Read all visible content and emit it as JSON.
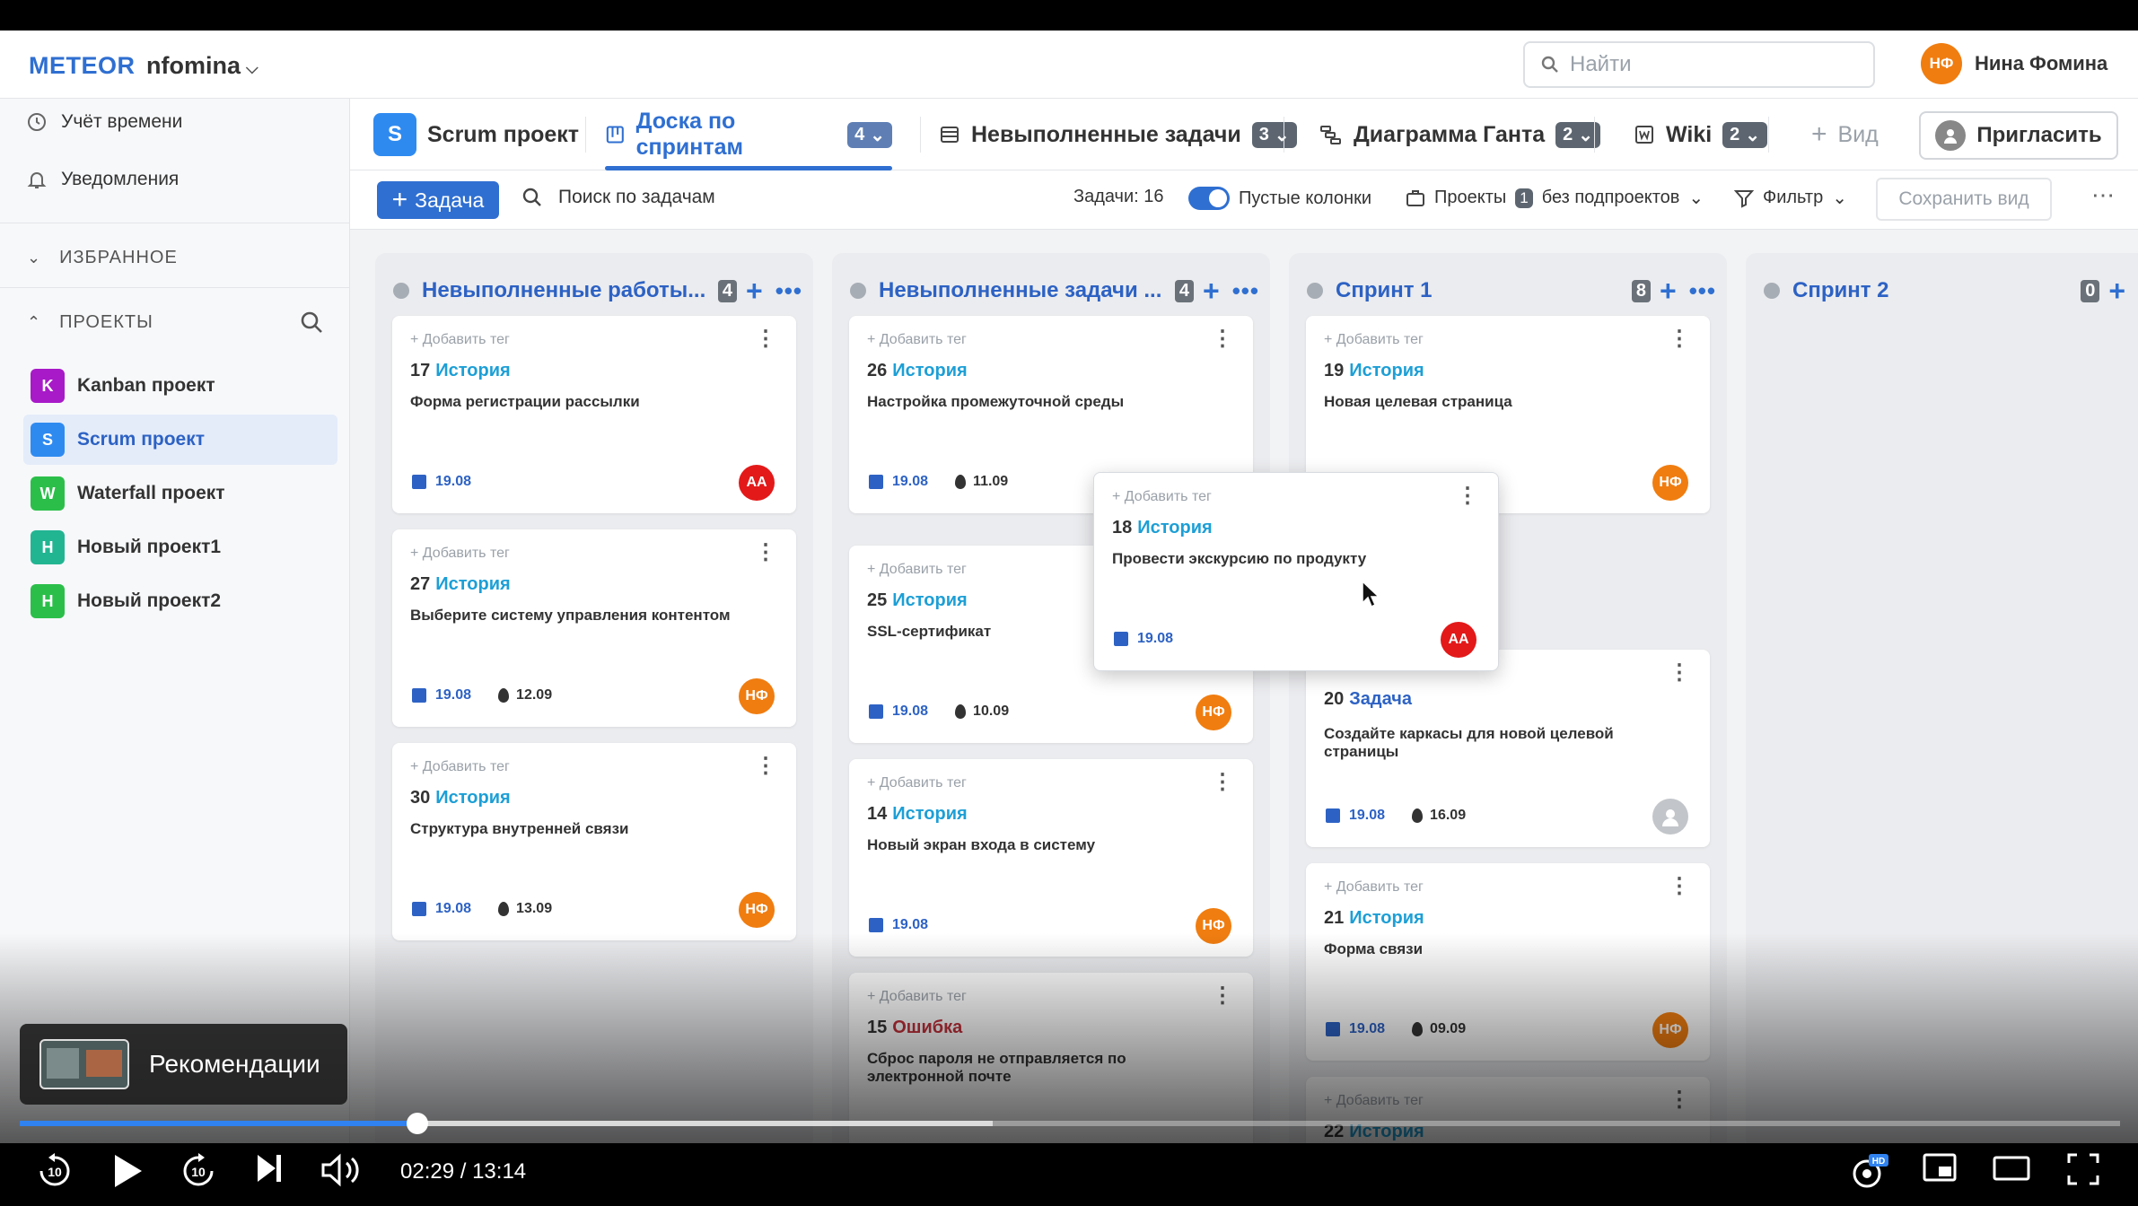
{
  "topbar": {
    "logo": "METEOR",
    "workspace": "nfomina",
    "search_placeholder": "Найти",
    "user_initials": "НФ",
    "user_name": "Нина Фомина"
  },
  "sidebar": {
    "time_tracking": "Учёт времени",
    "notifications": "Уведомления",
    "favorites_label": "ИЗБРАННОЕ",
    "projects_label": "ПРОЕКТЫ",
    "projects": [
      {
        "letter": "K",
        "name": "Kanban проект",
        "color": "#a81ac8"
      },
      {
        "letter": "S",
        "name": "Scrum проект",
        "color": "#2f8af0"
      },
      {
        "letter": "W",
        "name": "Waterfall проект",
        "color": "#2bbf4a"
      },
      {
        "letter": "Н",
        "name": "Новый проект1",
        "color": "#22b592"
      },
      {
        "letter": "Н",
        "name": "Новый проект2",
        "color": "#2bbf4a"
      }
    ]
  },
  "viewtabs": {
    "project_letter": "S",
    "project_name": "Scrum проект",
    "tabs": [
      {
        "label": "Доска по спринтам",
        "count": "4"
      },
      {
        "label": "Невыполненные задачи",
        "count": "3"
      },
      {
        "label": "Диаграмма Ганта",
        "count": "2"
      },
      {
        "label": "Wiki",
        "count": "2"
      }
    ],
    "add_view": "Вид",
    "invite": "Пригласить"
  },
  "toolbar": {
    "add_task": "Задача",
    "search_label": "Поиск по задачам",
    "tasks_count": "Задачи: 16",
    "empty_columns": "Пустые колонки",
    "projects": "Проекты",
    "projects_count": "1",
    "subprojects": "без подпроектов",
    "filter": "Фильтр",
    "save_view": "Сохранить вид"
  },
  "columns": [
    {
      "title": "Невыполненные работы...",
      "count": "4"
    },
    {
      "title": "Невыполненные задачи ...",
      "count": "4"
    },
    {
      "title": "Спринт 1",
      "count": "8"
    },
    {
      "title": "Спринт 2",
      "count": "0"
    }
  ],
  "cards": {
    "add_tag": "+ Добавить тег",
    "c17": {
      "num": "17",
      "type": "История",
      "desc": "Форма регистрации рассылки",
      "date": "19.08",
      "assignee": "АА"
    },
    "c27": {
      "num": "27",
      "type": "История",
      "desc": "Выберите систему управления контентом",
      "date": "19.08",
      "estimate": "12.09",
      "assignee": "НФ"
    },
    "c30": {
      "num": "30",
      "type": "История",
      "desc": "Структура внутренней связи",
      "date": "19.08",
      "estimate": "13.09",
      "assignee": "НФ"
    },
    "c26": {
      "num": "26",
      "type": "История",
      "desc": "Настройка промежуточной среды",
      "date": "19.08",
      "estimate": "11.09"
    },
    "c25": {
      "num": "25",
      "type": "История",
      "desc": "SSL-сертификат",
      "date": "19.08",
      "estimate": "10.09",
      "assignee": "НФ"
    },
    "c14": {
      "num": "14",
      "type": "История",
      "desc": "Новый экран входа в систему",
      "date": "19.08",
      "assignee": "НФ"
    },
    "c15": {
      "num": "15",
      "type": "Ошибка",
      "desc": "Сброс пароля не отправляется по электронной почте"
    },
    "c19": {
      "num": "19",
      "type": "История",
      "desc": "Новая целевая страница",
      "assignee": "НФ"
    },
    "c20": {
      "num": "20",
      "type": "Задача",
      "desc": "Создайте каркасы для новой целевой страницы",
      "date": "19.08",
      "estimate": "16.09"
    },
    "c21": {
      "num": "21",
      "type": "История",
      "desc": "Форма связи",
      "date": "19.08",
      "estimate": "09.09",
      "assignee": "НФ"
    },
    "c22": {
      "num": "22",
      "type": "История"
    },
    "c18": {
      "num": "18",
      "type": "История",
      "desc": "Провести экскурсию по продукту",
      "date": "19.08",
      "assignee": "АА"
    }
  },
  "player": {
    "recommendations": "Рекомендации",
    "current_time": "02:29",
    "separator": " / ",
    "duration": "13:14",
    "played_fraction": 0.1894,
    "buffered_fraction": 0.4634
  }
}
